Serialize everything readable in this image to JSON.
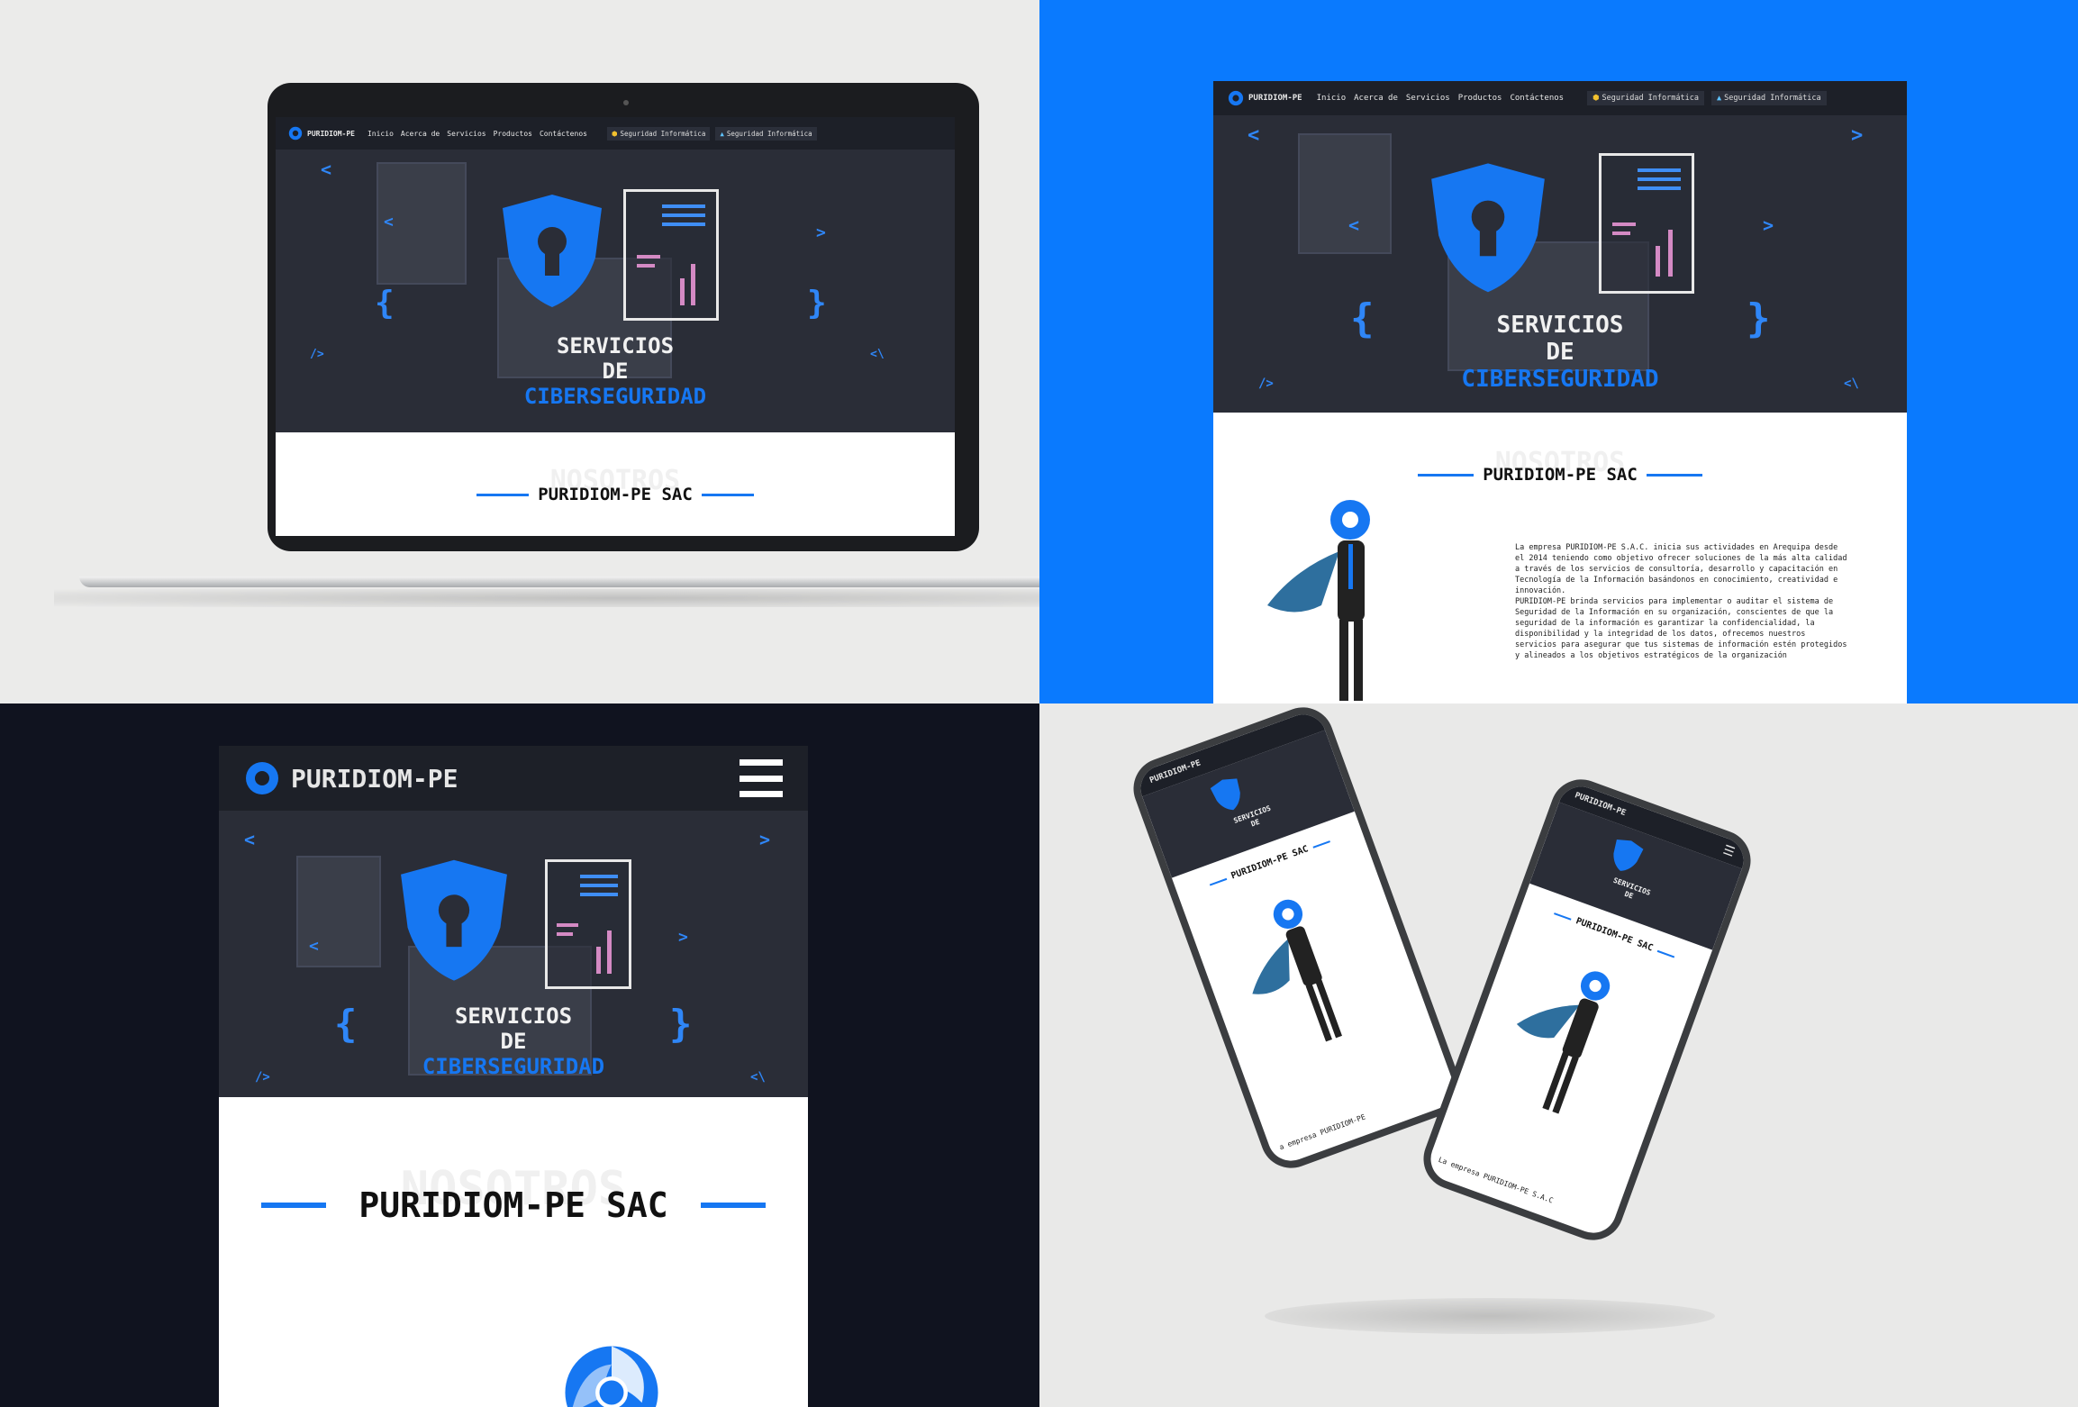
{
  "site": {
    "brand": "PURIDIOM-PE",
    "nav_links": [
      "Inicio",
      "Acerca de",
      "Servicios",
      "Productos",
      "Contáctenos"
    ],
    "badges": [
      "Seguridad Informática",
      "Seguridad Informática"
    ],
    "hero": {
      "line1": "SERVICIOS",
      "line2": "DE",
      "line3": "CIBERSEGURIDAD",
      "bg_poster_text": "PURIDIOM-PE"
    },
    "section": {
      "ghost": "NOSOTROS",
      "title": "PURIDIOM-PE SAC"
    },
    "about_text": "La empresa PURIDIOM-PE S.A.C. inicia sus actividades en Arequipa desde el 2014 teniendo como objetivo ofrecer soluciones de la más alta calidad a través de los servicios de consultoría, desarrollo y capacitación en Tecnología de la Información basándonos en conocimiento, creatividad e innovación.\nPURIDIOM-PE brinda servicios para implementar o auditar el sistema de Seguridad de la Información en su organización, conscientes de que la seguridad de la información es garantizar la confidencialidad, la disponibilidad y la integridad de los datos, ofrecemos nuestros servicios para asegurar que tus sistemas de información estén protegidos y alineados a los objetivos estratégicos de la organización",
    "phone_snippet_1": "a empresa PURIDIOM-PE",
    "phone_snippet_2": "La empresa PURIDIOM-PE S.A.C"
  },
  "colors": {
    "accent": "#1677f2",
    "q2_background": "#0a7afe",
    "q3_background": "#10131f",
    "nav_bg": "#1d2028",
    "hero_bg": "#2a2d37"
  },
  "icons": [
    "logo-icon",
    "shield-keyhole-icon",
    "report-document-icon",
    "hamburger-menu-icon",
    "superhero-mascot",
    "badge-icon"
  ]
}
